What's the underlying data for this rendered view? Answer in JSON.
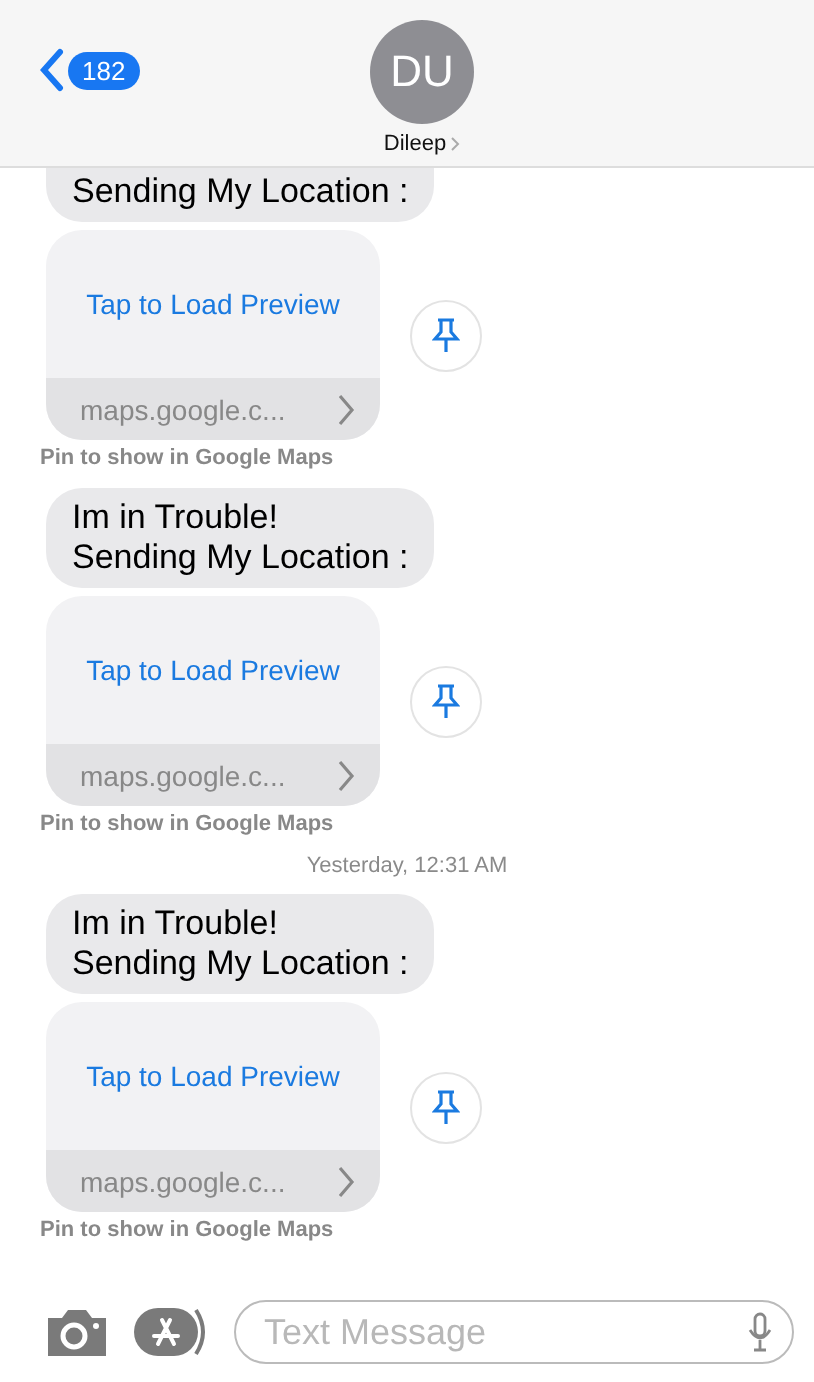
{
  "header": {
    "back_badge": "182",
    "avatar": "DU",
    "name": "Dileep"
  },
  "items": [
    {
      "kind": "message",
      "text": "Sending My Location :",
      "clipped": true
    },
    {
      "kind": "link",
      "action": "Tap to Load Preview",
      "url": "maps.google.c...",
      "caption": "Pin to show in Google Maps"
    },
    {
      "kind": "message",
      "text": "Im in Trouble!\nSending My Location :",
      "clipped": false
    },
    {
      "kind": "link",
      "action": "Tap to Load Preview",
      "url": "maps.google.c...",
      "caption": "Pin to show in Google Maps"
    },
    {
      "kind": "timestamp",
      "text": "Yesterday, 12:31 AM"
    },
    {
      "kind": "message",
      "text": "Im in Trouble!\nSending My Location :",
      "clipped": false
    },
    {
      "kind": "link",
      "action": "Tap to Load Preview",
      "url": "maps.google.c...",
      "caption": "Pin to show in Google Maps"
    }
  ],
  "composer": {
    "placeholder": "Text Message"
  }
}
